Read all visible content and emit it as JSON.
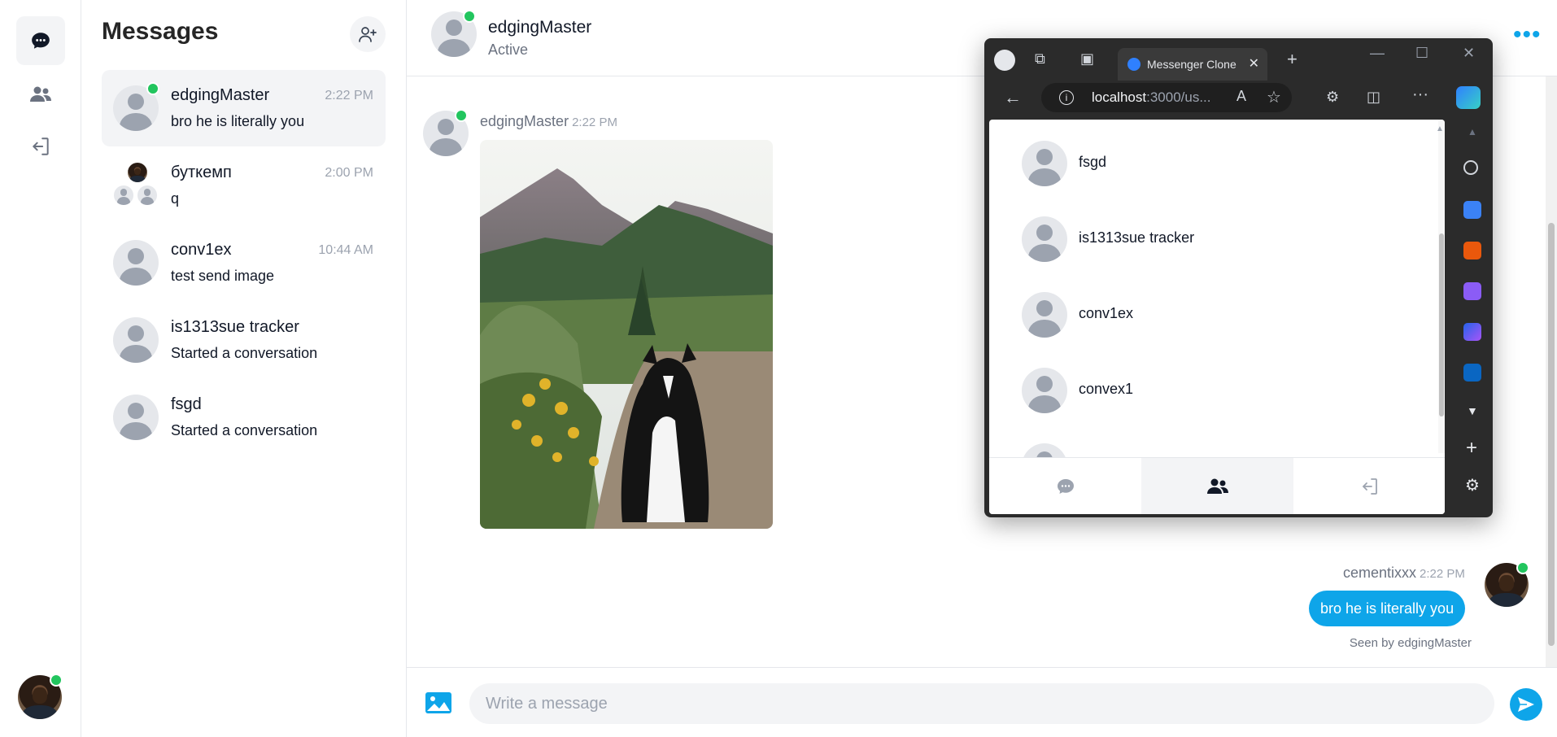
{
  "sidebar": {
    "items": [
      {
        "name": "messages",
        "icon": "chat-bubble-icon"
      },
      {
        "name": "users",
        "icon": "users-icon"
      },
      {
        "name": "logout",
        "icon": "logout-icon"
      }
    ],
    "current_user_avatar": "user-photo"
  },
  "conversations": {
    "title": "Messages",
    "add_user_icon": "add-user-icon",
    "items": [
      {
        "name": "edgingMaster",
        "time": "2:22 PM",
        "preview": "bro he is literally you",
        "online": true,
        "active": true
      },
      {
        "name": "буткемп",
        "time": "2:00 PM",
        "preview": "q",
        "group": true
      },
      {
        "name": "conv1ex",
        "time": "10:44 AM",
        "preview": "test send image"
      },
      {
        "name": "is1313sue tracker",
        "time": "",
        "preview": "Started a conversation"
      },
      {
        "name": "fsgd",
        "time": "",
        "preview": "Started a conversation"
      }
    ]
  },
  "chat": {
    "header": {
      "name": "edgingMaster",
      "status": "Active",
      "more_icon": "more-dots-icon"
    },
    "messages": [
      {
        "sender": "edgingMaster",
        "time": "2:22 PM",
        "type": "image",
        "image_desc": "dog-on-trail-photo"
      },
      {
        "sender": "cementixxx",
        "time": "2:22 PM",
        "type": "text",
        "text": "bro he is literally you",
        "seen": "Seen by edgingMaster"
      }
    ],
    "composer": {
      "placeholder": "Write a message",
      "image_icon": "image-icon",
      "send_icon": "send-icon"
    }
  },
  "browser": {
    "tab_title": "Messenger Clone",
    "url_host": "localhost",
    "url_rest": ":3000/us...",
    "users": [
      "fsgd",
      "is1313sue tracker",
      "conv1ex",
      "convex1"
    ],
    "nav": [
      "chat-bubble-icon",
      "users-icon",
      "logout-icon"
    ],
    "active_nav": 1
  },
  "colors": {
    "accent": "#0ea5e9",
    "online": "#22c55e",
    "active_bg": "#f3f4f6",
    "browser_dark": "#2b2b2b"
  }
}
